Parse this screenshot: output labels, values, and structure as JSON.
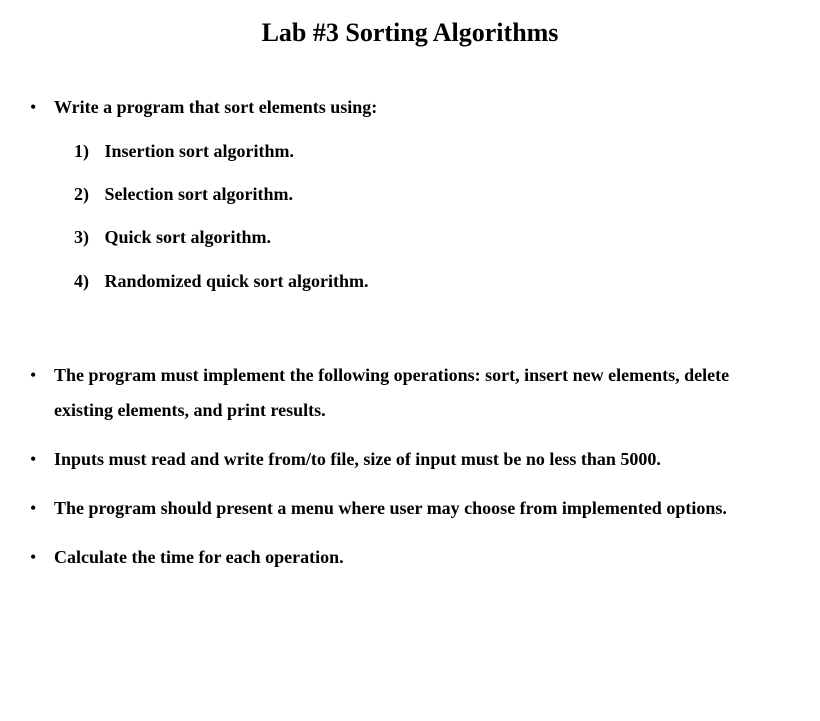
{
  "title": "Lab #3 Sorting Algorithms",
  "bullets": {
    "intro": "Write a program that sort elements using:",
    "sublist": [
      {
        "num": "1)",
        "text": "Insertion sort algorithm."
      },
      {
        "num": "2)",
        "text": "Selection sort algorithm."
      },
      {
        "num": "3)",
        "text": "Quick sort algorithm."
      },
      {
        "num": "4)",
        "text": "Randomized quick sort algorithm."
      }
    ],
    "b2": "The program must implement the following operations: sort, insert new elements, delete existing elements, and print results.",
    "b3": "Inputs must read and write from/to file, size of input must be no less than 5000.",
    "b4": "The program should present a menu where user may choose from implemented options.",
    "b5": "Calculate the time for each operation."
  }
}
